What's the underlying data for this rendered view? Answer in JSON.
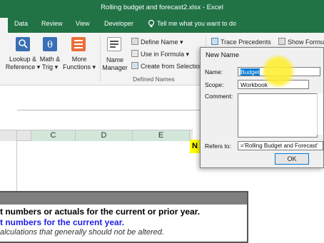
{
  "window": {
    "title": "Rolling budget and forecast2.xlsx  -  Excel"
  },
  "tabs": [
    {
      "label": "Data"
    },
    {
      "label": "Review"
    },
    {
      "label": "View"
    },
    {
      "label": "Developer"
    }
  ],
  "tell_me": "Tell me what you want to do",
  "ribbon": {
    "lookup": {
      "line1": "Lookup &",
      "line2": "Reference"
    },
    "math": {
      "line1": "Math &",
      "line2": "Trig"
    },
    "more": {
      "line1": "More",
      "line2": "Functions"
    },
    "name_manager": {
      "line1": "Name",
      "line2": "Manager"
    },
    "define_name": "Define Name",
    "use_in_formula": "Use in Formula",
    "create_from_selection": "Create from Selection",
    "defined_names_group": "Defined Names",
    "trace_precedents": "Trace Precedents",
    "show_formulas": "Show Formul"
  },
  "columns": [
    "C",
    "D",
    "E"
  ],
  "yellow_cell": "N",
  "notes": {
    "line1": "t numbers or actuals for the current or prior year.",
    "line2": "t numbers for the current year.",
    "line3": "alculations that generally should not be altered."
  },
  "dialog": {
    "title": "New Name",
    "name_label": "Name:",
    "name_value": "Budget",
    "scope_label": "Scope:",
    "scope_value": "Workbook",
    "comment_label": "Comment:",
    "refers_label": "Refers to:",
    "refers_value": "='Rolling Budget and Forecast'",
    "ok_label": "OK"
  }
}
